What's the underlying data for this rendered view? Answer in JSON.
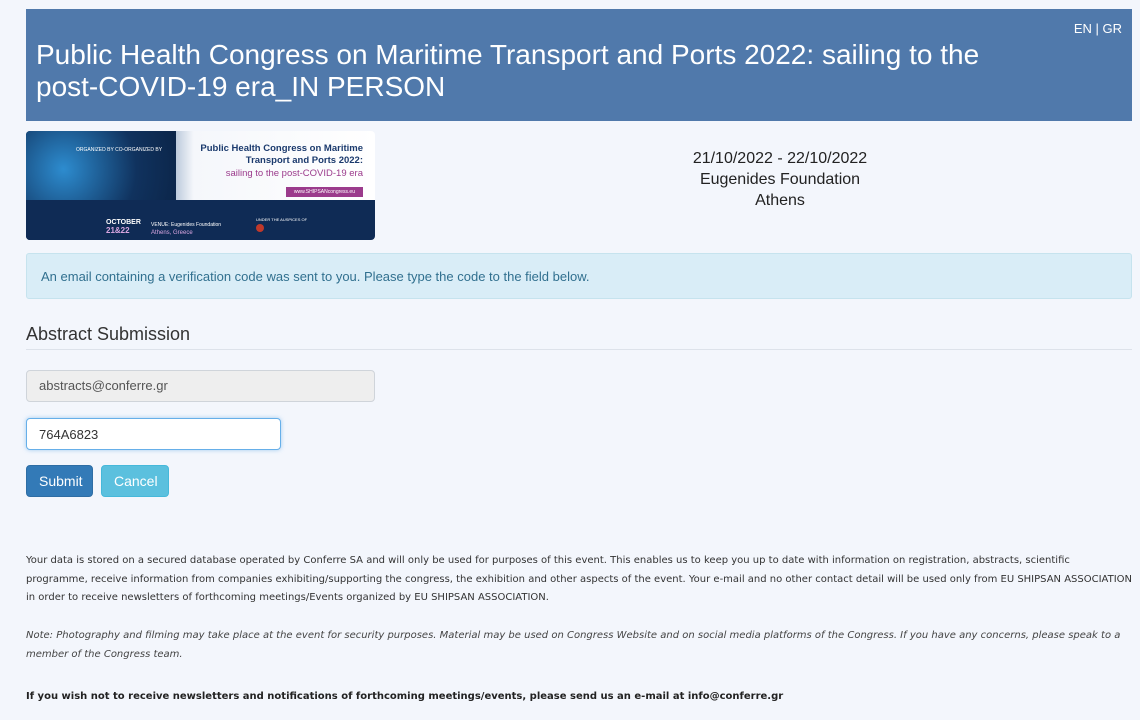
{
  "header": {
    "title": "Public Health Congress on Maritime Transport and Ports 2022: sailing to the post-COVID-19 era_IN PERSON",
    "lang_en": "EN",
    "lang_sep": " | ",
    "lang_gr": "GR"
  },
  "banner": {
    "orgs": "ORGANIZED BY   CO-ORGANIZED BY",
    "title": "Public Health Congress on Maritime Transport and Ports 2022:",
    "subtitle": "sailing to the post-COVID-19 era",
    "url": "www.SHIPSANcongress.eu",
    "month": "OCTOBER",
    "days": "21&22",
    "venue": "VENUE: Eugenides Foundation",
    "city": "Athens, Greece",
    "auspices": "UNDER THE AUSPICES OF"
  },
  "event": {
    "dates": "21/10/2022 - 22/10/2022",
    "venue": "Eugenides Foundation",
    "city": "Athens"
  },
  "alert": {
    "text": "An email containing a verification code was sent to you. Please type the code to the field below."
  },
  "form": {
    "section_title": "Abstract Submission",
    "email_value": "abstracts@conferre.gr",
    "code_value": "764A6823",
    "submit_label": "Submit",
    "cancel_label": "Cancel"
  },
  "footer": {
    "privacy": "Your data is stored on a secured database operated by Conferre SA and will only be used for purposes of this event. This enables us to keep you up to date with information on registration, abstracts, scientific programme, receive information from companies exhibiting/supporting the congress, the exhibition and other aspects of the event. Your e-mail and no other contact detail will be used only from EU SHIPSAN ASSOCIATION in order to receive newsletters of forthcoming meetings/Events organized by EU SHIPSAN ASSOCIATION.",
    "note": "Note: Photography and filming may take place at the event for security purposes. Material may be used on Congress Website and on social media platforms of the Congress. If you have any concerns, please speak to a member of the Congress team.",
    "unsubscribe": "If you wish not to receive newsletters and notifications of forthcoming meetings/events, please send us an e-mail at info@conferre.gr"
  }
}
